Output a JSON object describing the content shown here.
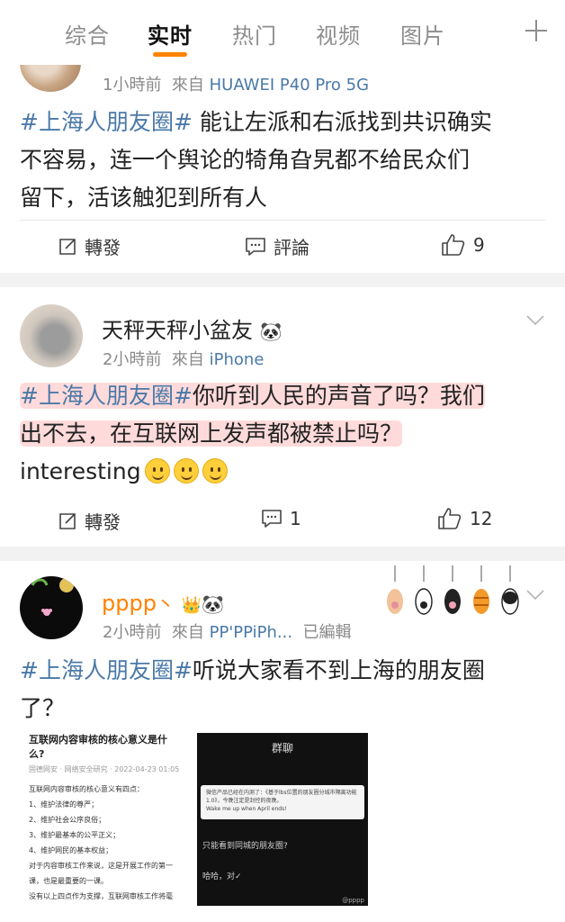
{
  "tabs": [
    "综合",
    "实时",
    "热门",
    "视频",
    "图片"
  ],
  "post1": {
    "time": "1小時前",
    "from_label": "來自",
    "source": "HUAWEI P40 Pro 5G",
    "hashtag": "#上海人朋友圈#",
    "lines": [
      "能让左派和右派找到共识确实",
      "不容易，连一个舆论的犄角旮旯都不给民众们",
      "留下，活该触犯到所有人"
    ],
    "repost_label": "轉發",
    "comment_label": "評論",
    "like_count": "9"
  },
  "post2": {
    "username": "天秤天秤小盆友",
    "time": "2小時前",
    "from_label": "來自",
    "source": "iPhone",
    "hashtag": "#上海人朋友圈#",
    "line1": "你听到人民的声音了吗？我们",
    "line2": "出不去，在互联网上发声都被禁止吗？",
    "line3": "interesting",
    "repost_label": "轉發",
    "comment_count": "1",
    "like_count": "12"
  },
  "post3": {
    "username": "pppp",
    "username_suffix": "丶",
    "time": "2小時前",
    "from_label": "來自",
    "source": "PP'PPiPh...",
    "edited": "已編輯",
    "hashtag": "#上海人朋友圈#",
    "text": "听说大家看不到上海的朋友圈",
    "text2": "了？",
    "doc_image": {
      "title_line1": "互联网内容审核的核心意义是什",
      "title_line2": "么?",
      "sub": "固德网安 · 网络安全研究 · 2022-04-23 01:05",
      "lines": [
        "互联网内容审核的核心意义有四点：",
        "1、维护法律的尊严；",
        "2、维护社会公序良俗；",
        "3、维护最基本的公平正义；",
        "4、维护网民的基本权益；",
        "对于内容审核工作来说，这是开展工作的第一",
        "课，也是最重要的一课。",
        "没有以上四点作为支撑，互联网审核工作将毫"
      ]
    },
    "chat_image": {
      "title": "群聊",
      "bubble_l1": "微信产品已经在内测了：《基于lbs位置的朋友圈分城市隔离功能1.0》，今晚注定是封控的夜晚。",
      "bubble_l2": "Wake me up when April ends!",
      "line1": "只能看到同城的朋友圈?",
      "line2": "哈哈，对✓",
      "watermark": "@pppp"
    }
  },
  "colors": {
    "accent": "#ff8200",
    "link": "#4a79a8",
    "gray_band": "#f2f2f2",
    "highlight": "#ffb3b3"
  }
}
